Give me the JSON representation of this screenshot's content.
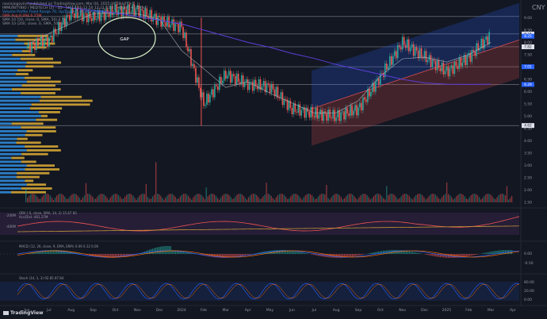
{
  "header": {
    "publisher_line": "navinjaigovind published on TradingView.com, Mar 04, 2025 10:59 UTC+1",
    "symbol_line": "IMMUNITYBIO / MEDTECH (2) · 1D · 5B  12.41  12.50  12.21  12.21 +0.34 (+1.59%)",
    "ind1": "Volume Profile Fixed Range 70, Up/Down  1.623M  4.468M",
    "ind2": "SMA Avg  8.494  6.25M",
    "ind3": "SMA 10 (50, close, 0, SMA, 50)  7.51",
    "ind4": "SMA 10 (200, close, 0, SMA, 50)  6.29"
  },
  "currency": "CNY",
  "brand": "TradingView",
  "annotation": "GAP",
  "price_axis": {
    "ticks": [
      "9.00",
      "8.50",
      "8.00",
      "7.50",
      "7.00",
      "6.50",
      "6.00",
      "5.50",
      "5.00",
      "4.50",
      "4.00",
      "3.50",
      "3.00",
      "2.50",
      "2.00",
      "1.50"
    ]
  },
  "price_labels": [
    {
      "text": "8.34",
      "color": "#e0e3eb"
    },
    {
      "text": "8.25",
      "color": "#2962ff"
    },
    {
      "text": "7.82",
      "color": "#e0e3eb"
    },
    {
      "text": "7.01",
      "color": "#2962ff"
    },
    {
      "text": "6.29",
      "color": "#2962ff"
    },
    {
      "text": "4.62",
      "color": "#e0e3eb"
    }
  ],
  "time_axis": {
    "ticks": [
      "Jun",
      "Jul",
      "Aug",
      "Sep",
      "Oct",
      "Nov",
      "Dec",
      "2024",
      "Feb",
      "Mar",
      "Apr",
      "May",
      "Jun",
      "Jul",
      "Aug",
      "Sep",
      "Oct",
      "Nov",
      "Dec",
      "2025",
      "Feb",
      "Mar",
      "Apr"
    ]
  },
  "panels": {
    "obv": {
      "title": "Acc/Dist  -461.27M",
      "label": "OBV (-S, close, SMA, 14, 2)  15.67  60",
      "ticks": [
        "-200M",
        "-400M"
      ]
    },
    "macd": {
      "title": "MACD (12, 26, close, 9, EMA, EMA)  0.06  0.12  0.06",
      "ticks": [
        "0.00",
        "-0.50"
      ]
    },
    "stoch": {
      "title": "Stoch (14, 1, 3)  92.85  87.84",
      "ticks": [
        "80.00",
        "20.00",
        "0.00"
      ]
    }
  },
  "colors": {
    "up": "#26a69a",
    "down": "#ef5350",
    "sma50": "#b2b5be",
    "sma200": "#5b3fd8",
    "gold": "#d4a534",
    "blue": "#2f8ad9"
  },
  "chart_data": {
    "type": "candlestick",
    "y_range": [
      1.4,
      9.4
    ],
    "approx_close_path": [
      {
        "t": "2023-06",
        "price": 7.8
      },
      {
        "t": "2023-07",
        "price": 8.1
      },
      {
        "t": "2023-08",
        "price": 9.2
      },
      {
        "t": "2023-09",
        "price": 9.0
      },
      {
        "t": "2023-10",
        "price": 9.3
      },
      {
        "t": "2023-11",
        "price": 9.3
      },
      {
        "t": "2023-12",
        "price": 8.9
      },
      {
        "t": "2024-01",
        "price": 8.6
      },
      {
        "t": "2024-02",
        "price": 5.5
      },
      {
        "t": "2024-03",
        "price": 6.7
      },
      {
        "t": "2024-04",
        "price": 6.3
      },
      {
        "t": "2024-05",
        "price": 6.2
      },
      {
        "t": "2024-06",
        "price": 5.3
      },
      {
        "t": "2024-07",
        "price": 5.1
      },
      {
        "t": "2024-08",
        "price": 5.0
      },
      {
        "t": "2024-09",
        "price": 5.3
      },
      {
        "t": "2024-10",
        "price": 6.6
      },
      {
        "t": "2024-11",
        "price": 8.0
      },
      {
        "t": "2024-12",
        "price": 7.4
      },
      {
        "t": "2025-01",
        "price": 6.8
      },
      {
        "t": "2025-02",
        "price": 7.4
      },
      {
        "t": "2025-03",
        "price": 8.3
      }
    ]
  }
}
